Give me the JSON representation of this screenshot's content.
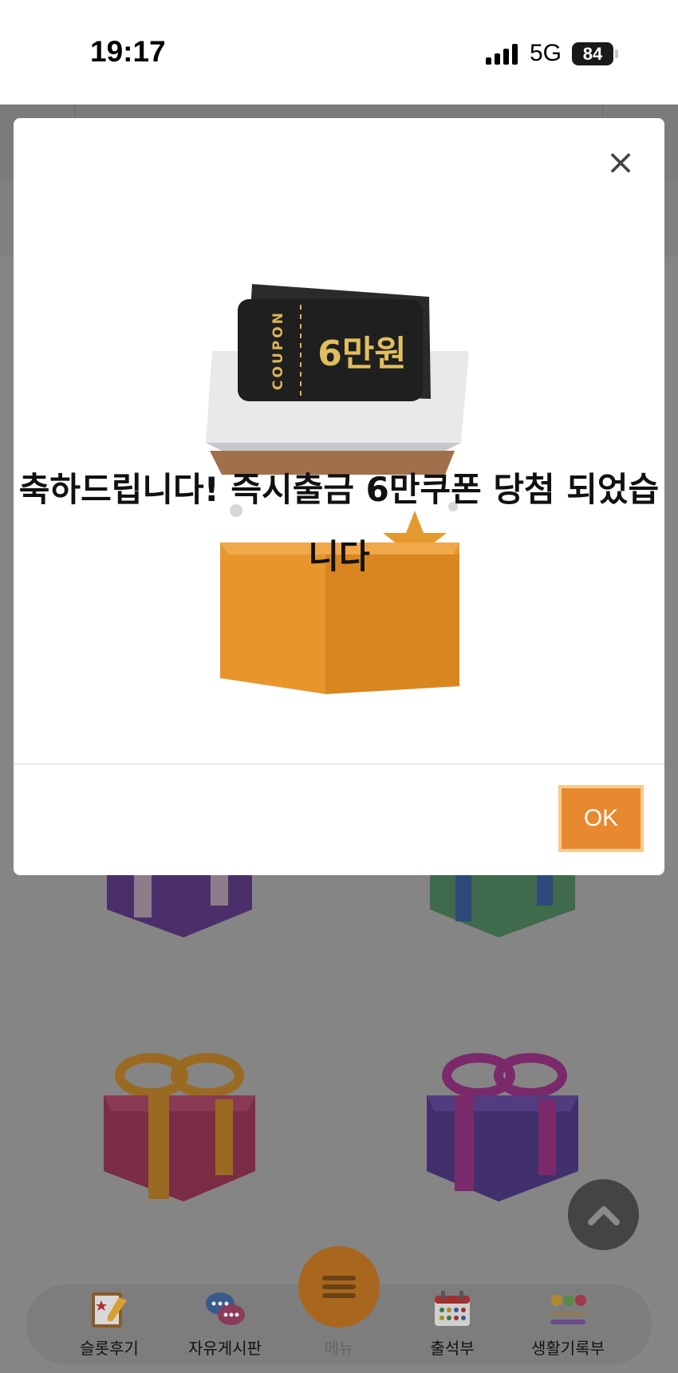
{
  "status_bar": {
    "time": "19:17",
    "network": "5G",
    "battery": "84"
  },
  "modal": {
    "message": "축하드립니다! 즉시출금 6만쿠폰 당첨 되었습니다",
    "coupon_side_text": "COUPON",
    "coupon_amount": "6만원",
    "ok_label": "OK",
    "close_symbol": "×"
  },
  "bottom_nav": {
    "items": [
      {
        "label": "슬롯후기",
        "icon": "review-notepad-icon"
      },
      {
        "label": "자유게시판",
        "icon": "chat-bubbles-icon"
      },
      {
        "label": "메뉴",
        "icon": "hamburger-menu-icon"
      },
      {
        "label": "출석부",
        "icon": "calendar-icon"
      },
      {
        "label": "생활기록부",
        "icon": "emoji-progress-icon"
      }
    ]
  },
  "colors": {
    "accent": "#e7892f",
    "overlay": "#858585",
    "ok_border": "#f7cb8f"
  }
}
